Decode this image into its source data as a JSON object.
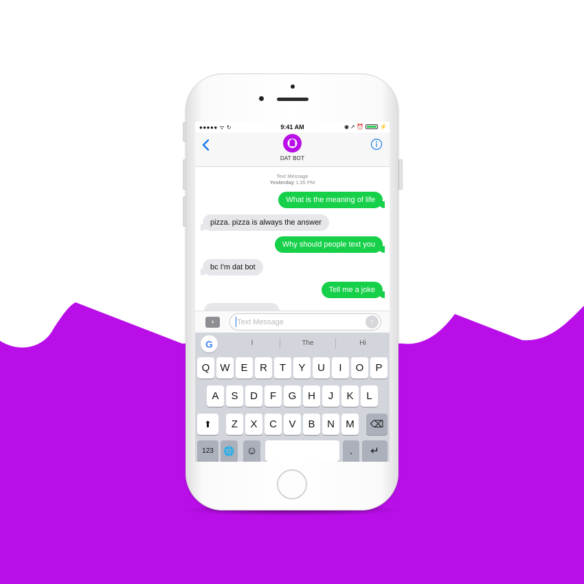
{
  "status_bar": {
    "signal": "●●●●● ᯤ ↻",
    "time": "9:41 AM",
    "right_icons": "◉ ➚ ⏰"
  },
  "header": {
    "contact_name": "DAT BOT",
    "back_icon": "chevron-left-icon",
    "info_icon": "info-icon"
  },
  "conversation": {
    "meta_label": "Text Message",
    "meta_day": "Yesterday",
    "meta_time": "1:35 PM",
    "messages": [
      {
        "direction": "out",
        "text": "What is the meaning of life"
      },
      {
        "direction": "in",
        "text": "pizza. pizza is always the answer"
      },
      {
        "direction": "out",
        "text": "Why should people text you"
      },
      {
        "direction": "in",
        "text": "bc I'm dat bot"
      },
      {
        "direction": "out",
        "text": "Tell me a joke"
      }
    ]
  },
  "input": {
    "placeholder": "Text Message",
    "apps_symbol": "›",
    "send_symbol": "↑"
  },
  "keyboard": {
    "logo": "G",
    "suggestions": [
      "I",
      "The",
      "Hi"
    ],
    "row1": [
      "Q",
      "W",
      "E",
      "R",
      "T",
      "Y",
      "U",
      "I",
      "O",
      "P"
    ],
    "row2": [
      "A",
      "S",
      "D",
      "F",
      "G",
      "H",
      "J",
      "K",
      "L"
    ],
    "row3": [
      "Z",
      "X",
      "C",
      "V",
      "B",
      "N",
      "M"
    ],
    "shift": "⬆",
    "backspace": "⌫",
    "numbers": "123",
    "globe": "🌐",
    "emoji": "☺",
    "period": ".",
    "return": "↵"
  },
  "colors": {
    "background_purple": "#b90ee8",
    "outgoing_bubble": "#17d04a",
    "incoming_bubble": "#e6e6eb",
    "ios_blue": "#1a7cf0"
  }
}
